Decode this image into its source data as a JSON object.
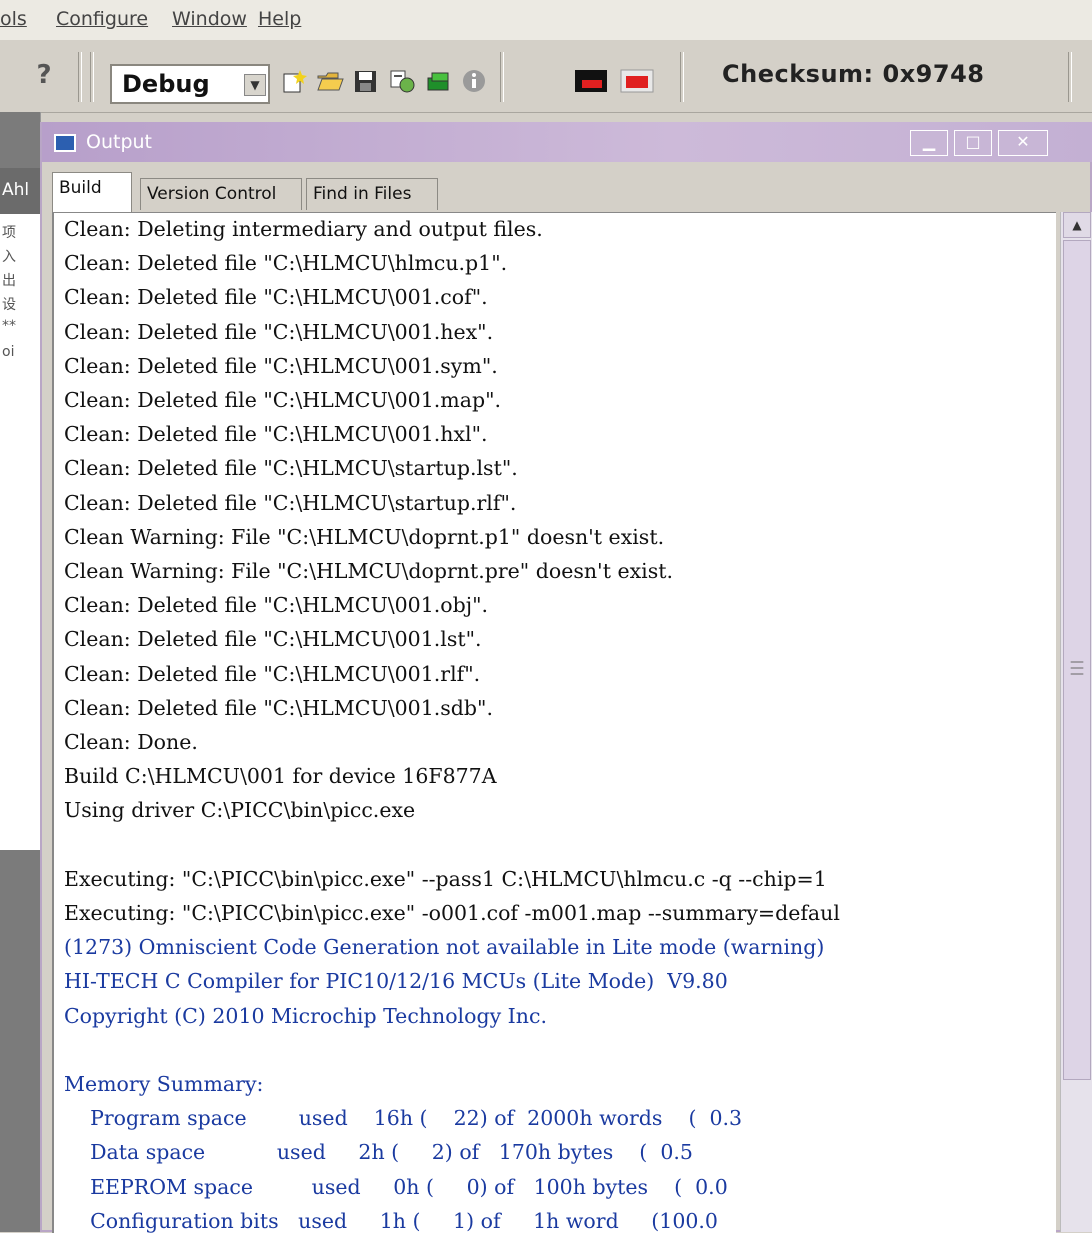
{
  "menu": [
    "ols",
    "Configure",
    "Window",
    "Help"
  ],
  "toolbar": {
    "config_value": "Debug",
    "checksum": "Checksum:  0x9748",
    "icons": [
      "help-icon",
      "new-file-icon",
      "open-folder-icon",
      "save-icon",
      "build-icon",
      "build-all-icon",
      "info-icon",
      "red-flag-icon",
      "red-flag-icon"
    ]
  },
  "left_panel": {
    "tab_text": "Ahl",
    "lines": [
      "项",
      "入",
      "出",
      "设",
      "**",
      "oi"
    ]
  },
  "output": {
    "title": "Output",
    "tabs": [
      "Build",
      "Version Control",
      "Find in Files"
    ],
    "lines": [
      {
        "text": "Clean: Deleting intermediary and output files.",
        "color": "black"
      },
      {
        "text": "Clean: Deleted file \"C:\\HLMCU\\hlmcu.p1\".",
        "color": "black"
      },
      {
        "text": "Clean: Deleted file \"C:\\HLMCU\\001.cof\".",
        "color": "black"
      },
      {
        "text": "Clean: Deleted file \"C:\\HLMCU\\001.hex\".",
        "color": "black"
      },
      {
        "text": "Clean: Deleted file \"C:\\HLMCU\\001.sym\".",
        "color": "black"
      },
      {
        "text": "Clean: Deleted file \"C:\\HLMCU\\001.map\".",
        "color": "black"
      },
      {
        "text": "Clean: Deleted file \"C:\\HLMCU\\001.hxl\".",
        "color": "black"
      },
      {
        "text": "Clean: Deleted file \"C:\\HLMCU\\startup.lst\".",
        "color": "black"
      },
      {
        "text": "Clean: Deleted file \"C:\\HLMCU\\startup.rlf\".",
        "color": "black"
      },
      {
        "text": "Clean Warning: File \"C:\\HLMCU\\doprnt.p1\" doesn't exist.",
        "color": "black"
      },
      {
        "text": "Clean Warning: File \"C:\\HLMCU\\doprnt.pre\" doesn't exist.",
        "color": "black"
      },
      {
        "text": "Clean: Deleted file \"C:\\HLMCU\\001.obj\".",
        "color": "black"
      },
      {
        "text": "Clean: Deleted file \"C:\\HLMCU\\001.lst\".",
        "color": "black"
      },
      {
        "text": "Clean: Deleted file \"C:\\HLMCU\\001.rlf\".",
        "color": "black"
      },
      {
        "text": "Clean: Deleted file \"C:\\HLMCU\\001.sdb\".",
        "color": "black"
      },
      {
        "text": "Clean: Done.",
        "color": "black"
      },
      {
        "text": "Build C:\\HLMCU\\001 for device 16F877A",
        "color": "black"
      },
      {
        "text": "Using driver C:\\PICC\\bin\\picc.exe",
        "color": "black"
      },
      {
        "text": "",
        "color": "black"
      },
      {
        "text": "Executing: \"C:\\PICC\\bin\\picc.exe\" --pass1 C:\\HLMCU\\hlmcu.c -q --chip=1",
        "color": "black"
      },
      {
        "text": "Executing: \"C:\\PICC\\bin\\picc.exe\" -o001.cof -m001.map --summary=defaul",
        "color": "black"
      },
      {
        "text": "(1273) Omniscient Code Generation not available in Lite mode (warning)",
        "color": "blue"
      },
      {
        "text": "HI-TECH C Compiler for PIC10/12/16 MCUs (Lite Mode)  V9.80",
        "color": "blue"
      },
      {
        "text": "Copyright (C) 2010 Microchip Technology Inc.",
        "color": "blue"
      },
      {
        "text": "",
        "color": "blue"
      },
      {
        "text": "Memory Summary:",
        "color": "blue"
      },
      {
        "text": "    Program space        used    16h (    22) of  2000h words    (  0.3",
        "color": "blue"
      },
      {
        "text": "    Data space           used     2h (     2) of   170h bytes    (  0.5",
        "color": "blue"
      },
      {
        "text": "    EEPROM space         used     0h (     0) of   100h bytes    (  0.0",
        "color": "blue"
      },
      {
        "text": "    Configuration bits   used     1h (     1) of     1h word     (100.0",
        "color": "blue"
      }
    ]
  },
  "colors": {
    "text_black": "#111111",
    "text_blue": "#1a3aa0",
    "titlebar": "#b79fca"
  }
}
